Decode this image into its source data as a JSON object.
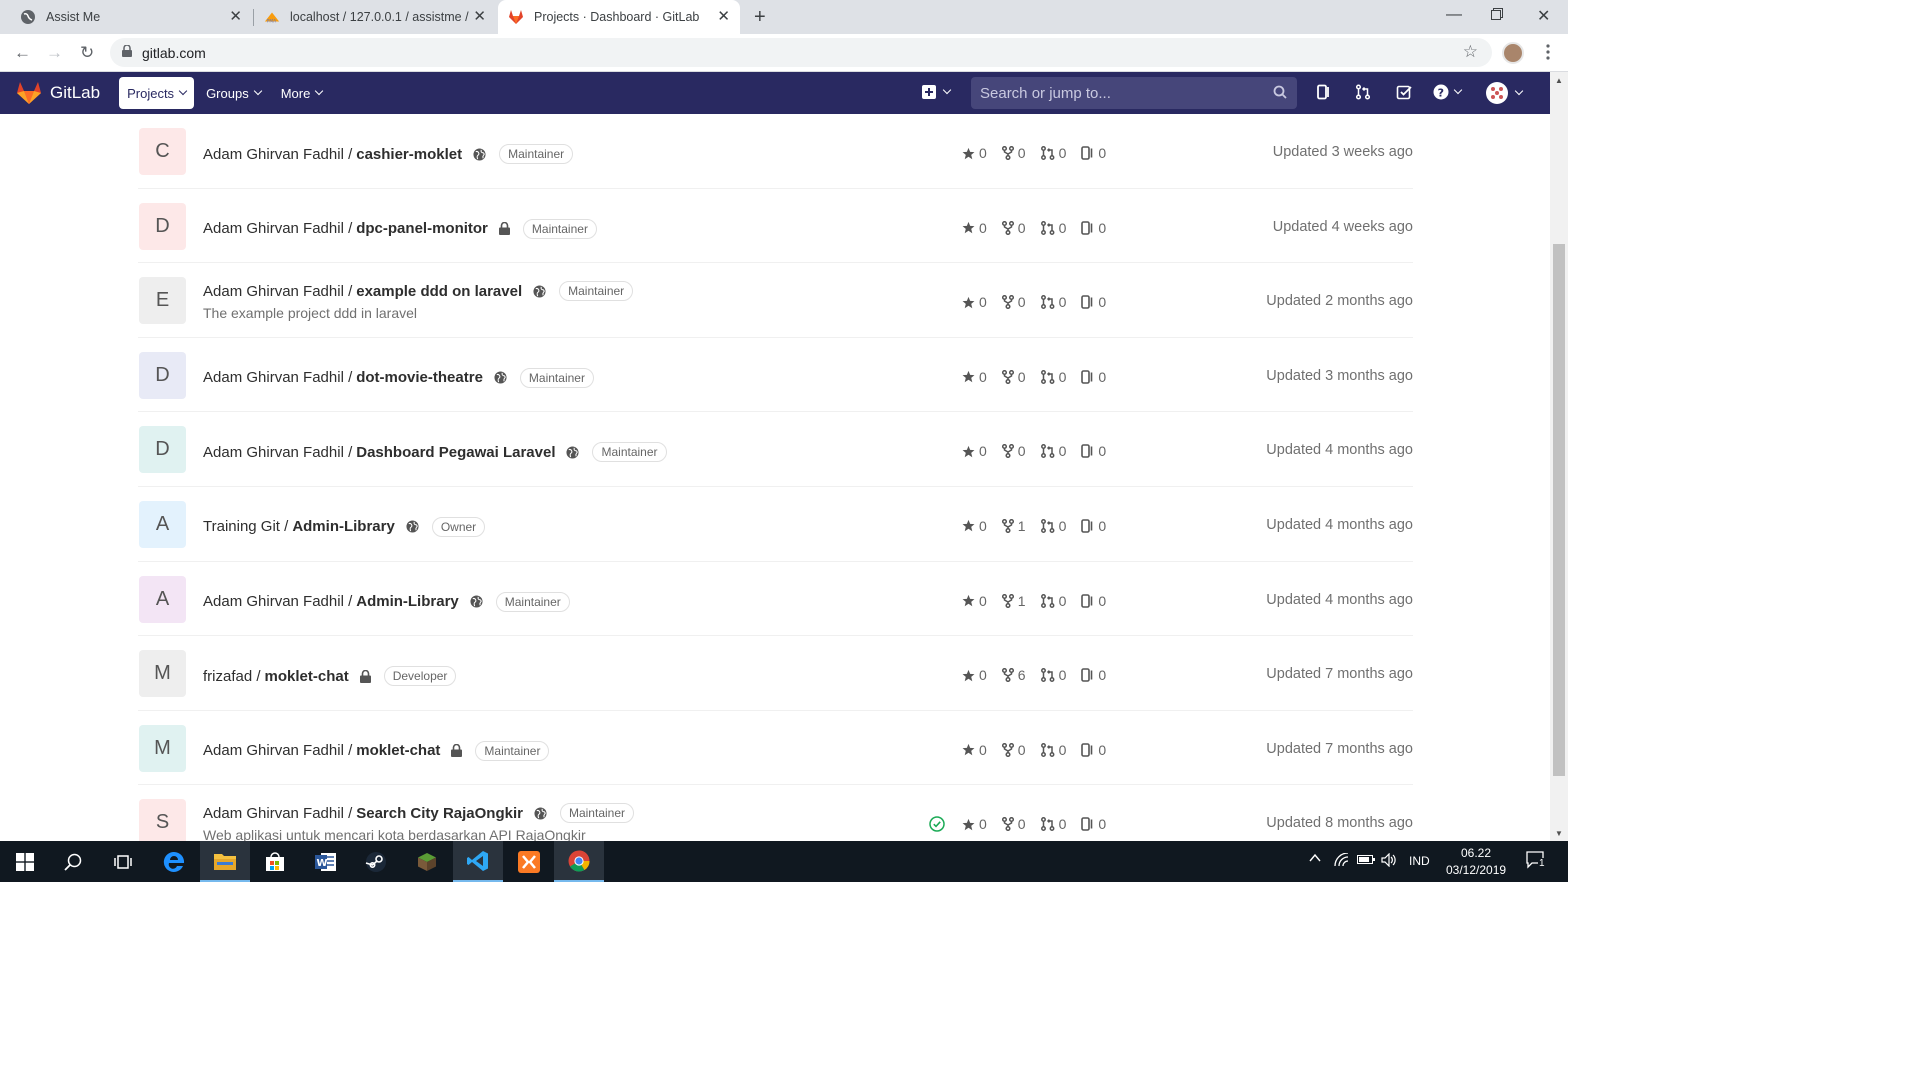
{
  "browser": {
    "tabs": [
      {
        "title": "Assist Me",
        "active": false
      },
      {
        "title": "localhost / 127.0.0.1 / assistme / ",
        "active": false
      },
      {
        "title": "Projects · Dashboard · GitLab",
        "active": true
      }
    ],
    "url": "gitlab.com"
  },
  "gitlab": {
    "brand": "GitLab",
    "nav": {
      "projects": "Projects",
      "groups": "Groups",
      "more": "More"
    },
    "search_placeholder": "Search or jump to...",
    "colors": {
      "navbar": "#292961",
      "search_bg": "#46467a"
    }
  },
  "projects": [
    {
      "letter": "C",
      "avatar_bg": "#fde8e8",
      "namespace": "Adam Ghirvan Fadhil /",
      "name": "cashier-moklet",
      "visibility": "public",
      "role": "Maintainer",
      "description": "",
      "stars": "0",
      "forks": "0",
      "merge_requests": "0",
      "issues": "0",
      "updated": "Updated 3 weeks ago",
      "ci": false
    },
    {
      "letter": "D",
      "avatar_bg": "#fde8e8",
      "namespace": "Adam Ghirvan Fadhil /",
      "name": "dpc-panel-monitor",
      "visibility": "private",
      "role": "Maintainer",
      "description": "",
      "stars": "0",
      "forks": "0",
      "merge_requests": "0",
      "issues": "0",
      "updated": "Updated 4 weeks ago",
      "ci": false
    },
    {
      "letter": "E",
      "avatar_bg": "#eeeeee",
      "namespace": "Adam Ghirvan Fadhil /",
      "name": "example ddd on laravel",
      "visibility": "public",
      "role": "Maintainer",
      "description": "The example project ddd in laravel",
      "stars": "0",
      "forks": "0",
      "merge_requests": "0",
      "issues": "0",
      "updated": "Updated 2 months ago",
      "ci": false
    },
    {
      "letter": "D",
      "avatar_bg": "#e8eaf6",
      "namespace": "Adam Ghirvan Fadhil /",
      "name": "dot-movie-theatre",
      "visibility": "public",
      "role": "Maintainer",
      "description": "",
      "stars": "0",
      "forks": "0",
      "merge_requests": "0",
      "issues": "0",
      "updated": "Updated 3 months ago",
      "ci": false
    },
    {
      "letter": "D",
      "avatar_bg": "#e0f2f1",
      "namespace": "Adam Ghirvan Fadhil /",
      "name": "Dashboard Pegawai Laravel",
      "visibility": "public",
      "role": "Maintainer",
      "description": "",
      "stars": "0",
      "forks": "0",
      "merge_requests": "0",
      "issues": "0",
      "updated": "Updated 4 months ago",
      "ci": false
    },
    {
      "letter": "A",
      "avatar_bg": "#e3f2fd",
      "namespace": "Training Git /",
      "name": "Admin-Library",
      "visibility": "public",
      "role": "Owner",
      "description": "",
      "stars": "0",
      "forks": "1",
      "merge_requests": "0",
      "issues": "0",
      "updated": "Updated 4 months ago",
      "ci": false
    },
    {
      "letter": "A",
      "avatar_bg": "#f3e5f5",
      "namespace": "Adam Ghirvan Fadhil /",
      "name": "Admin-Library",
      "visibility": "public",
      "role": "Maintainer",
      "description": "",
      "stars": "0",
      "forks": "1",
      "merge_requests": "0",
      "issues": "0",
      "updated": "Updated 4 months ago",
      "ci": false
    },
    {
      "letter": "M",
      "avatar_bg": "#eeeeee",
      "namespace": "frizafad /",
      "name": "moklet-chat",
      "visibility": "private",
      "role": "Developer",
      "description": "",
      "stars": "0",
      "forks": "6",
      "merge_requests": "0",
      "issues": "0",
      "updated": "Updated 7 months ago",
      "ci": false
    },
    {
      "letter": "M",
      "avatar_bg": "#e0f2f1",
      "namespace": "Adam Ghirvan Fadhil /",
      "name": "moklet-chat",
      "visibility": "private",
      "role": "Maintainer",
      "description": "",
      "stars": "0",
      "forks": "0",
      "merge_requests": "0",
      "issues": "0",
      "updated": "Updated 7 months ago",
      "ci": false
    },
    {
      "letter": "S",
      "avatar_bg": "#fde8e8",
      "namespace": "Adam Ghirvan Fadhil /",
      "name": "Search City RajaOngkir",
      "visibility": "public",
      "role": "Maintainer",
      "description": "Web aplikasi untuk mencari kota berdasarkan API RajaOngkir",
      "stars": "0",
      "forks": "0",
      "merge_requests": "0",
      "issues": "0",
      "updated": "Updated 8 months ago",
      "ci": true
    }
  ],
  "taskbar": {
    "language": "IND",
    "time": "06.22",
    "date": "03/12/2019",
    "notifications": "1"
  }
}
